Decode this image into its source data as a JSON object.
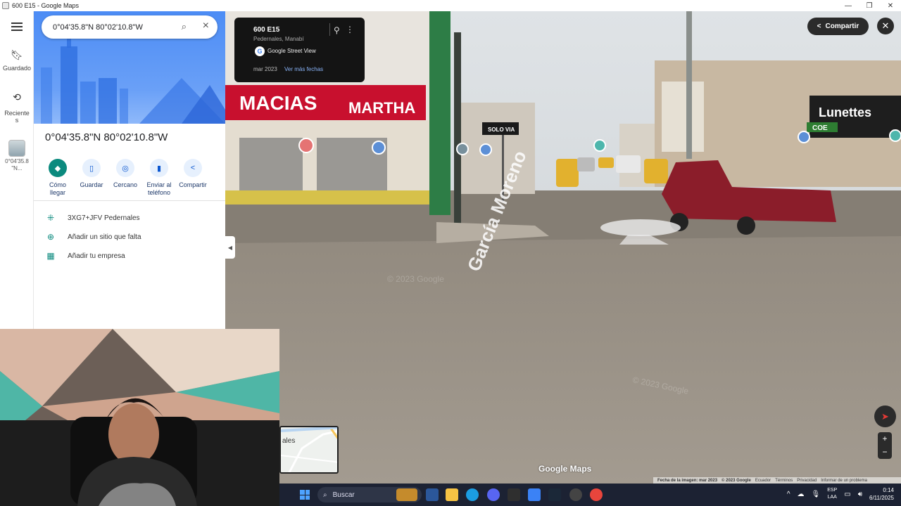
{
  "window": {
    "title": "600 E15 - Google Maps",
    "controls": [
      "—",
      "❐",
      "✕"
    ]
  },
  "rail": {
    "saved_label": "Guardado",
    "recent_label": "Reciente\ns",
    "thumb_label": "0°04'35.8\n\"N..."
  },
  "search": {
    "value": "0°04'35.8\"N 80°02'10.8\"W"
  },
  "place": {
    "coords": "0°04'35.8\"N 80°02'10.8\"W",
    "actions": [
      {
        "label": "Cómo llegar",
        "icon": "directions-icon"
      },
      {
        "label": "Guardar",
        "icon": "bookmark-icon"
      },
      {
        "label": "Cercano",
        "icon": "nearby-icon"
      },
      {
        "label": "Enviar al teléfono",
        "icon": "phone-icon"
      },
      {
        "label": "Compartir",
        "icon": "share-icon"
      }
    ],
    "info": [
      {
        "text": "3XG7+JFV Pedernales",
        "icon": "plus-code-icon"
      },
      {
        "text": "Añadir un sitio que falta",
        "icon": "add-place-icon"
      },
      {
        "text": "Añadir tu empresa",
        "icon": "add-business-icon"
      }
    ]
  },
  "street_view": {
    "card": {
      "title": "600 E15",
      "subtitle": "Pedernales, Manabí",
      "source": "Google Street View",
      "date": "mar 2023",
      "more_dates": "Ver más fechas"
    },
    "share_label": "Compartir",
    "street_name": "García Moreno",
    "signs": [
      "MACIAS",
      "MARTHA",
      "SOLO VIA",
      "Lunettes",
      "COE"
    ],
    "watermark": "© 2023 Google",
    "logo": "Google Maps",
    "footer": [
      "Fecha de la imagen: mar 2023",
      "© 2023 Google",
      "Ecuador",
      "Términos",
      "Privacidad",
      "Informar de un problema"
    ],
    "zoom_in": "+",
    "zoom_out": "−"
  },
  "minimap": {
    "label": "ales"
  },
  "taskbar": {
    "search_placeholder": "Buscar",
    "lang_top": "ESP",
    "lang_bottom": "LAA",
    "time": "0:14",
    "date": "6/11/2025"
  },
  "colors": {
    "accent": "#0b57d0",
    "teal": "#0b8a7e",
    "hero": "#4c8cf5",
    "dark_ui": "#2b2b2b"
  }
}
